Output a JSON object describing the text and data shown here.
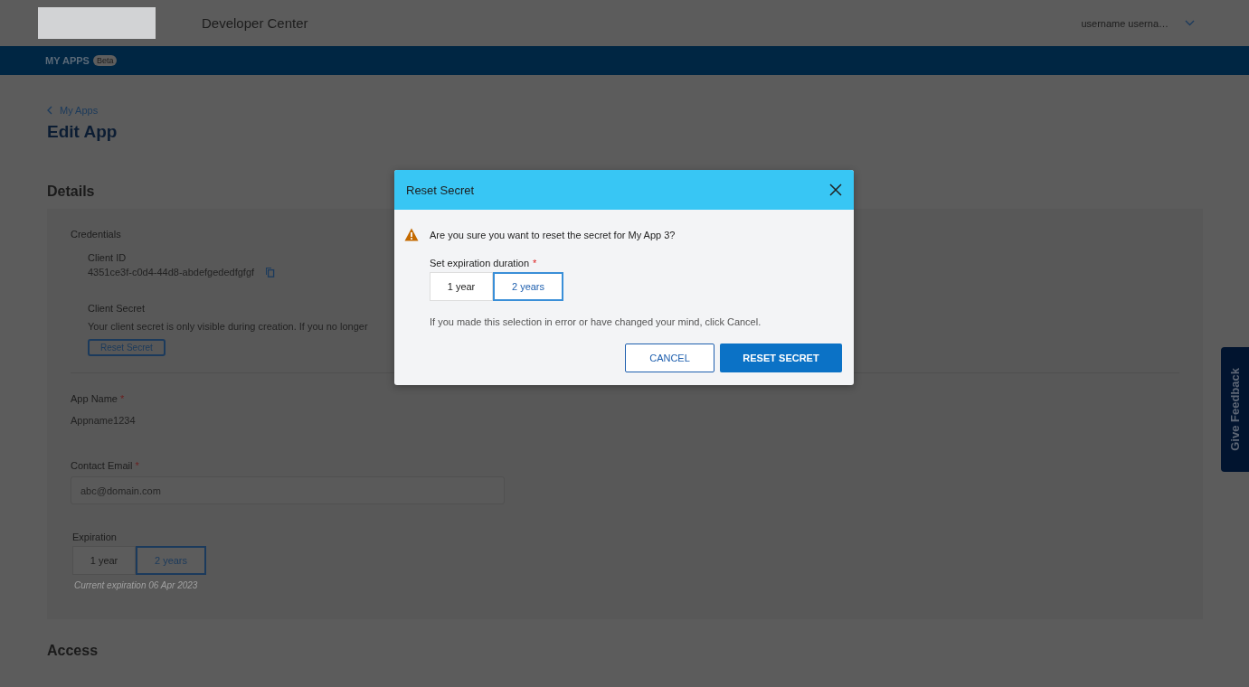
{
  "header": {
    "title": "Developer Center",
    "user_menu": "username userna…"
  },
  "nav": {
    "items": [
      {
        "label": "MY APPS",
        "badge": "Beta"
      }
    ]
  },
  "page": {
    "back_link": "My Apps",
    "title": "Edit App"
  },
  "details": {
    "heading": "Details",
    "credentials": {
      "heading": "Credentials",
      "client_id_label": "Client ID",
      "client_id": "4351ce3f-c0d4-44d8-abdefgededfgfgf",
      "client_secret_label": "Client Secret",
      "client_secret_description": "Your client secret is only visible during creation. If you no longer",
      "reset_button": "Reset Secret"
    },
    "app_name": {
      "label": "App Name",
      "required_mark": "*",
      "value": "Appname1234"
    },
    "contact_email": {
      "label": "Contact Email",
      "required_mark": "*",
      "placeholder": "abc@domain.com"
    },
    "expiration": {
      "label": "Expiration",
      "options": [
        {
          "label": "1 year",
          "selected": false
        },
        {
          "label": "2 years",
          "selected": true
        }
      ],
      "hint": "Current expiration 06 Apr 2023"
    }
  },
  "access": {
    "heading": "Access"
  },
  "dialog": {
    "title": "Reset Secret",
    "message": "Are you sure you want to reset the secret for My App 3?",
    "duration_label": "Set expiration duration",
    "required_mark": "*",
    "options": [
      {
        "label": "1 year",
        "selected": false
      },
      {
        "label": "2 years",
        "selected": true
      }
    ],
    "note": "If you made this selection in error or have changed your mind, click Cancel.",
    "buttons": [
      {
        "label": "CANCEL",
        "kind": "secondary"
      },
      {
        "label": "RESET SECRET",
        "kind": "primary"
      }
    ]
  },
  "feedback_tab": {
    "label": "Give Feedback"
  }
}
